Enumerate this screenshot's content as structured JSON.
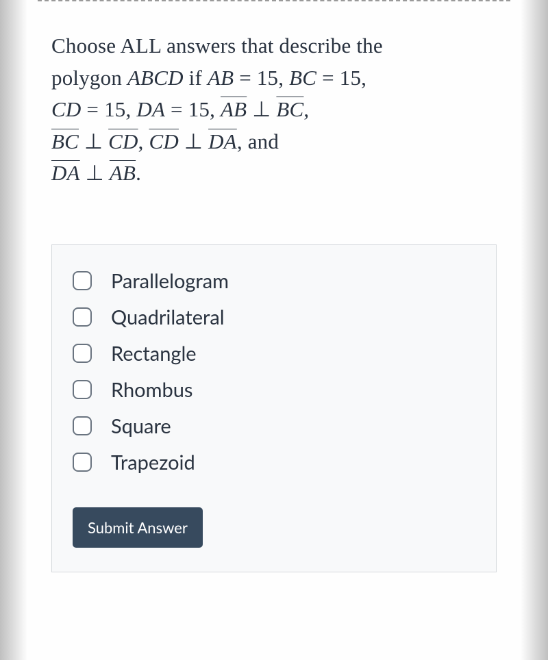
{
  "question": {
    "line1_pre": "Choose ALL answers that describe the",
    "line2_pre": "polygon ",
    "polygon": "ABCD",
    "if_text": " if ",
    "ab_eq": "AB",
    "bc_eq": "BC",
    "cd_eq": "CD",
    "da_eq": "DA",
    "val_15": "15",
    "and_text": ", and",
    "perp_text": "  ⊥  "
  },
  "options": [
    {
      "label": "Parallelogram"
    },
    {
      "label": "Quadrilateral"
    },
    {
      "label": "Rectangle"
    },
    {
      "label": "Rhombus"
    },
    {
      "label": "Square"
    },
    {
      "label": "Trapezoid"
    }
  ],
  "submit_label": "Submit Answer"
}
